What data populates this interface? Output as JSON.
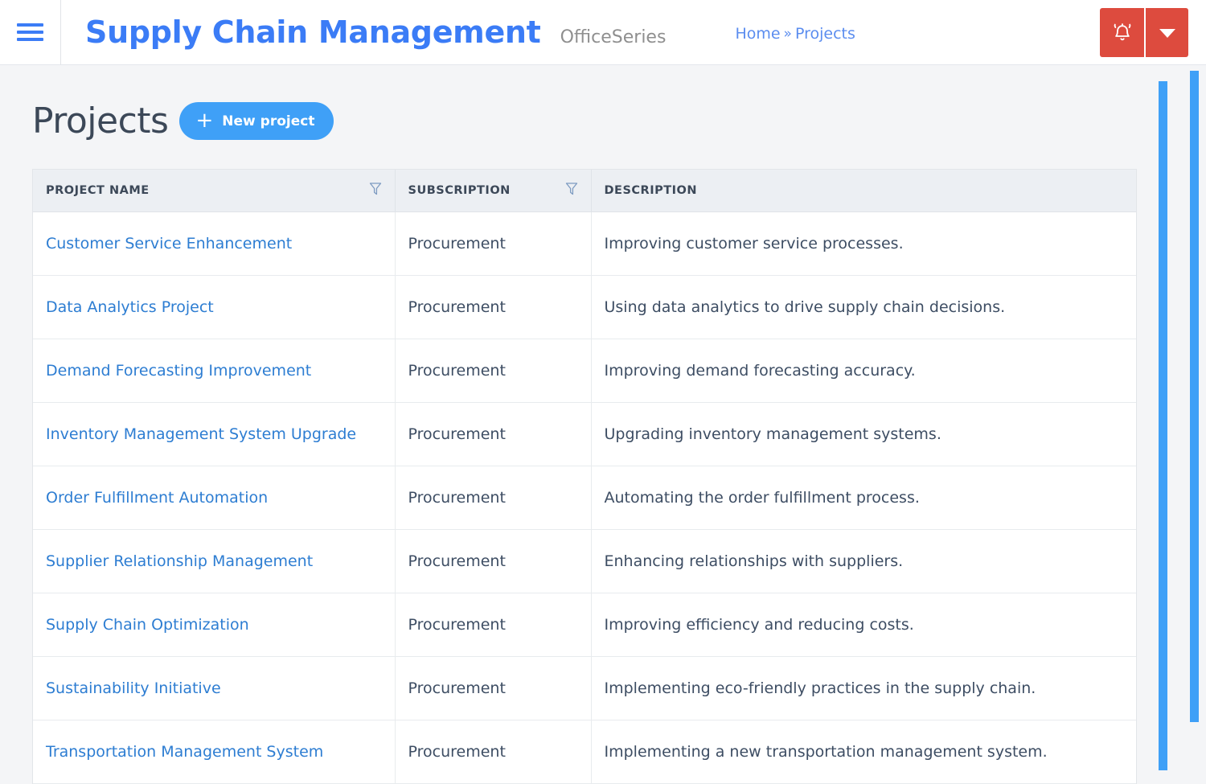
{
  "topbar": {
    "menu_icon": "hamburger-icon",
    "brand_title": "Supply Chain Management",
    "brand_subtitle": "OfficeSeries",
    "breadcrumb": {
      "home": "Home",
      "separator": "»",
      "current": "Projects"
    },
    "actions": {
      "alarm_icon": "bell-icon",
      "caret_icon": "chevron-down-icon",
      "button_color": "#dd4b3e"
    }
  },
  "main": {
    "title": "Projects",
    "new_project_button": {
      "icon": "plus-icon",
      "label": "New project",
      "color": "#3fa0f7"
    },
    "table": {
      "columns": [
        {
          "label": "PROJECT NAME",
          "filterable": true
        },
        {
          "label": "SUBSCRIPTION",
          "filterable": true
        },
        {
          "label": "DESCRIPTION",
          "filterable": false
        }
      ],
      "rows": [
        {
          "name": "Customer Service Enhancement",
          "subscription": "Procurement",
          "description": "Improving customer service processes."
        },
        {
          "name": "Data Analytics Project",
          "subscription": "Procurement",
          "description": "Using data analytics to drive supply chain decisions."
        },
        {
          "name": "Demand Forecasting Improvement",
          "subscription": "Procurement",
          "description": "Improving demand forecasting accuracy."
        },
        {
          "name": "Inventory Management System Upgrade",
          "subscription": "Procurement",
          "description": "Upgrading inventory management systems."
        },
        {
          "name": "Order Fulfillment Automation",
          "subscription": "Procurement",
          "description": "Automating the order fulfillment process."
        },
        {
          "name": "Supplier Relationship Management",
          "subscription": "Procurement",
          "description": "Enhancing relationships with suppliers."
        },
        {
          "name": "Supply Chain Optimization",
          "subscription": "Procurement",
          "description": "Improving efficiency and reducing costs."
        },
        {
          "name": "Sustainability Initiative",
          "subscription": "Procurement",
          "description": "Implementing eco-friendly practices in the supply chain."
        },
        {
          "name": "Transportation Management System",
          "subscription": "Procurement",
          "description": "Implementing a new transportation management system."
        }
      ]
    }
  },
  "scrollbars": {
    "inner_color": "#3fa0f7",
    "outer_color": "#3fa0f7"
  },
  "theme": {
    "brand_blue": "#3b7cf6",
    "link_blue": "#2d7dd2",
    "accent_blue": "#3fa0f7",
    "danger_red": "#dd4b3e",
    "page_bg": "#f4f5f7",
    "header_bg": "#eceff3"
  }
}
